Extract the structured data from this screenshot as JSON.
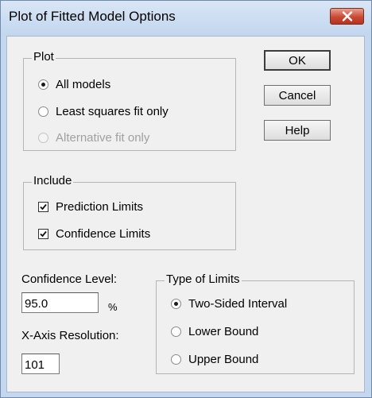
{
  "window": {
    "title": "Plot of Fitted Model Options"
  },
  "plot_group": {
    "legend": "Plot",
    "options": [
      {
        "label": "All models",
        "checked": true,
        "enabled": true
      },
      {
        "label": "Least squares fit only",
        "checked": false,
        "enabled": true
      },
      {
        "label": "Alternative fit only",
        "checked": false,
        "enabled": false
      }
    ]
  },
  "buttons": {
    "ok": "OK",
    "cancel": "Cancel",
    "help": "Help"
  },
  "include_group": {
    "legend": "Include",
    "options": [
      {
        "label": "Prediction Limits",
        "checked": true
      },
      {
        "label": "Confidence Limits",
        "checked": true
      }
    ]
  },
  "confidence_level": {
    "label": "Confidence Level:",
    "value": "95.0",
    "unit": "%"
  },
  "x_axis_resolution": {
    "label": "X-Axis Resolution:",
    "value": "101"
  },
  "limits_group": {
    "legend": "Type of Limits",
    "options": [
      {
        "label": "Two-Sided Interval",
        "checked": true
      },
      {
        "label": "Lower Bound",
        "checked": false
      },
      {
        "label": "Upper Bound",
        "checked": false
      }
    ]
  }
}
